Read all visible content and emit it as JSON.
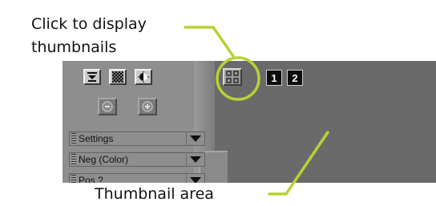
{
  "callouts": {
    "thumbnails_line1": "Click to display",
    "thumbnails_line2": "thumbnails",
    "thumbnail_area": "Thumbnail area"
  },
  "panel": {
    "dropdowns": [
      {
        "label": "Settings"
      },
      {
        "label": "Neg (Color)"
      },
      {
        "label": "Pos ?"
      }
    ]
  },
  "toolbar": {
    "frame_buttons": [
      "1",
      "2"
    ]
  },
  "colors": {
    "callout_accent": "#b5d334",
    "panel_gray": "#8e8e8e",
    "thumb_area": "#6a6a6a"
  },
  "icons": [
    "eject-icon",
    "checker-icon",
    "contrast-icon",
    "zoom-out-icon",
    "zoom-in-icon",
    "thumbnails-grid-icon"
  ]
}
